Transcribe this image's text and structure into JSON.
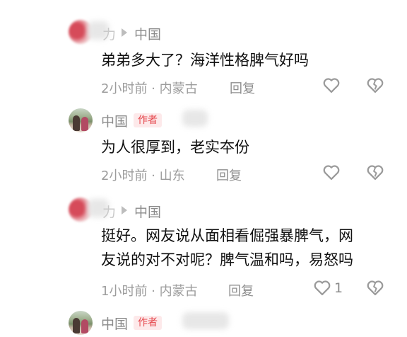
{
  "comments": [
    {
      "ip_location": "中国",
      "name_visible_char": "力",
      "text_lines": [
        "弟弟多大了？海洋性格脾气好吗"
      ],
      "time": "2小时前 · 内蒙古",
      "reply_label": "回复"
    },
    {
      "name": "中国",
      "author_badge": "作者",
      "text_lines": [
        "为人很厚到，老实夲份"
      ],
      "time": "2小时前 · 山东",
      "reply_label": "回复"
    },
    {
      "ip_location": "中国",
      "name_visible_char": "力",
      "text_lines": [
        "挺好。网友说从面相看倔强暴脾气，网",
        "友说的对不对呢？脾气温和吗，易怒吗"
      ],
      "time": "1小时前 · 内蒙古",
      "reply_label": "回复",
      "like_count": "1"
    },
    {
      "name": "中国",
      "author_badge": "作者"
    }
  ],
  "icons": {
    "like": "heart-outline-icon",
    "dislike": "broken-heart-icon",
    "separator": "play-triangle-icon"
  },
  "colors": {
    "author_badge_text": "#e5484d",
    "author_badge_bg": "#fde9ea"
  }
}
